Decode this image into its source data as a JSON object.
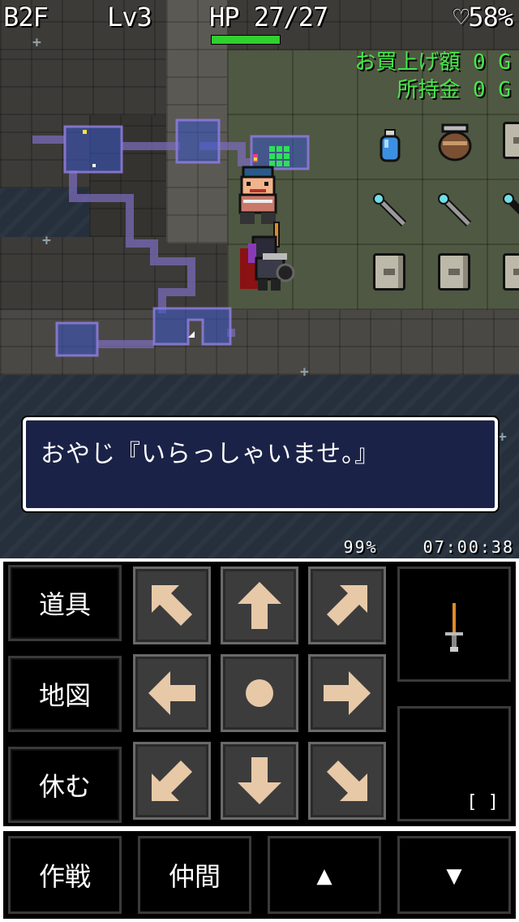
{
  "hud": {
    "floor": "B2F",
    "level": "Lv3",
    "hp": "HP 27/27",
    "hp_fraction": 1.0,
    "satiety": "♡58%"
  },
  "shop": {
    "purchase_total": "お買上げ額 0 G",
    "money": "所持金 0 G"
  },
  "message": "おやじ『いらっしゃいませ。』",
  "status": {
    "percent": "99%",
    "clock": "07:00:38"
  },
  "side_buttons": {
    "items": "道具",
    "map": "地図",
    "rest": "休む"
  },
  "slots": {
    "weapon_icon": "sword-icon",
    "shield_label": "[ ]"
  },
  "bottom_buttons": {
    "tactics": "作戦",
    "party": "仲間",
    "up": "▲",
    "down": "▼"
  },
  "dpad": [
    "up-left",
    "up",
    "up-right",
    "left",
    "wait",
    "right",
    "down-left",
    "down",
    "down-right"
  ],
  "colors": {
    "shop_text": "#46e64b",
    "hp_bar": "#2fd02f",
    "message_bg": "#1a2247",
    "dpad_arrow": "#e7c9a8",
    "minimap": "#3a57c8"
  }
}
